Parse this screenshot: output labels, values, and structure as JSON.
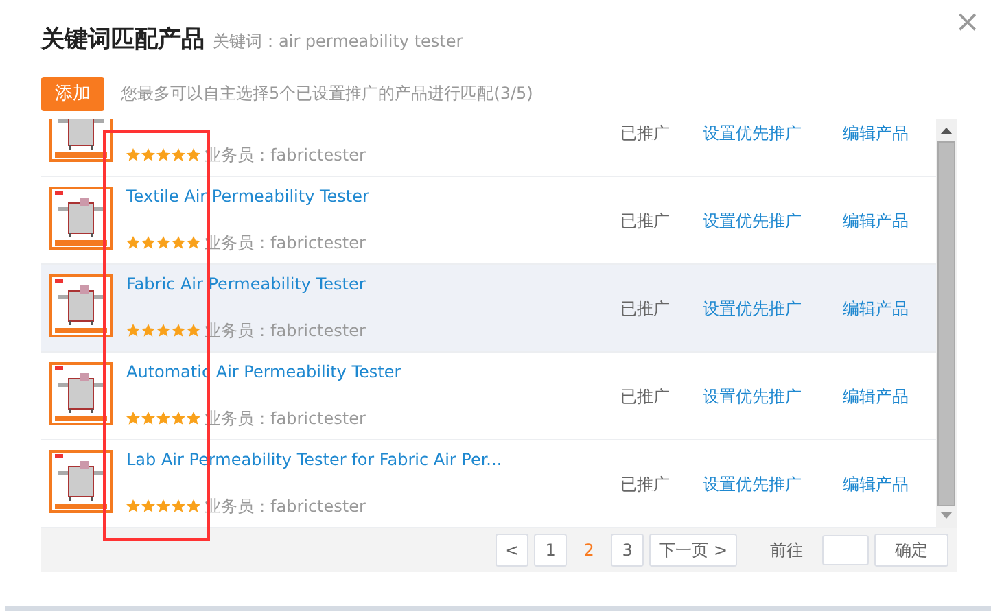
{
  "dialog": {
    "title": "关键词匹配产品",
    "keyword": "关键词：air permeability tester",
    "close": "×"
  },
  "toolbar": {
    "add_button": "添加",
    "hint": "您最多可以自主选择5个已设置推广的产品进行匹配(3/5)"
  },
  "products": [
    {
      "stars": 5,
      "salesperson": "业务员：fabrictester",
      "status": "已推广",
      "priority_link": "设置优先推广",
      "edit_link": "编辑产品",
      "highlighted": false
    },
    {
      "title": "Textile Air Permeability Tester",
      "stars": 5,
      "salesperson": "业务员：fabrictester",
      "status": "已推广",
      "priority_link": "设置优先推广",
      "edit_link": "编辑产品",
      "highlighted": false
    },
    {
      "title": "Fabric Air Permeability Tester",
      "stars": 5,
      "salesperson": "业务员：fabrictester",
      "status": "已推广",
      "priority_link": "设置优先推广",
      "edit_link": "编辑产品",
      "highlighted": true
    },
    {
      "title": "Automatic Air Permeability Tester",
      "stars": 5,
      "salesperson": "业务员：fabrictester",
      "status": "已推广",
      "priority_link": "设置优先推广",
      "edit_link": "编辑产品",
      "highlighted": false
    },
    {
      "title": "Lab Air Permeability Tester for Fabric Air Per...",
      "stars": 5,
      "salesperson": "业务员：fabrictester",
      "status": "已推广",
      "priority_link": "设置优先推广",
      "edit_link": "编辑产品",
      "highlighted": false
    }
  ],
  "pagination": {
    "prev": "<",
    "pages": [
      {
        "label": "1",
        "selected": false
      },
      {
        "label": "2",
        "selected": true
      },
      {
        "label": "3",
        "selected": false
      }
    ],
    "next": "下一页 >",
    "goto_label": "前往",
    "confirm": "确定"
  }
}
